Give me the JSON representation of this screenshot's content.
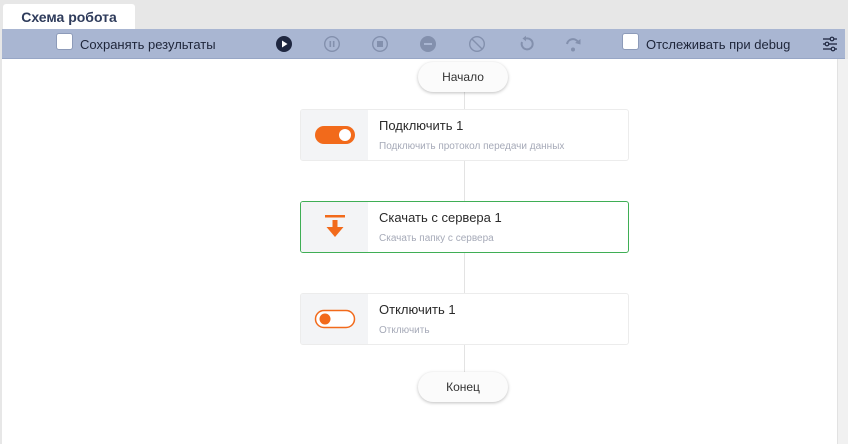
{
  "tab": {
    "title": "Схема робота"
  },
  "toolbar": {
    "save_results_label": "Сохранять результаты",
    "save_results_checked": false,
    "track_debug_label": "Отслеживать при debug",
    "track_debug_checked": false,
    "buttons": [
      "play-icon",
      "pause-icon",
      "stop-icon",
      "stop-minus-icon",
      "cancel-icon",
      "restart-icon",
      "step-over-icon",
      "settings-sliders-icon"
    ]
  },
  "flow": {
    "start_label": "Начало",
    "end_label": "Конец",
    "nodes": [
      {
        "title": "Подключить  1",
        "subtitle": "Подключить протокол передачи данных",
        "icon": "toggle-on-icon"
      },
      {
        "title": "Скачать с сервера  1",
        "subtitle": "Скачать папку с сервера",
        "icon": "download-icon",
        "selected": true
      },
      {
        "title": "Отключить  1",
        "subtitle": "Отключить",
        "icon": "toggle-off-icon"
      }
    ]
  },
  "colors": {
    "accent": "#f26a1b",
    "toolbar": "#a9b6d2",
    "selected_border": "#3fae55",
    "tab_text": "#2e3b5b"
  }
}
